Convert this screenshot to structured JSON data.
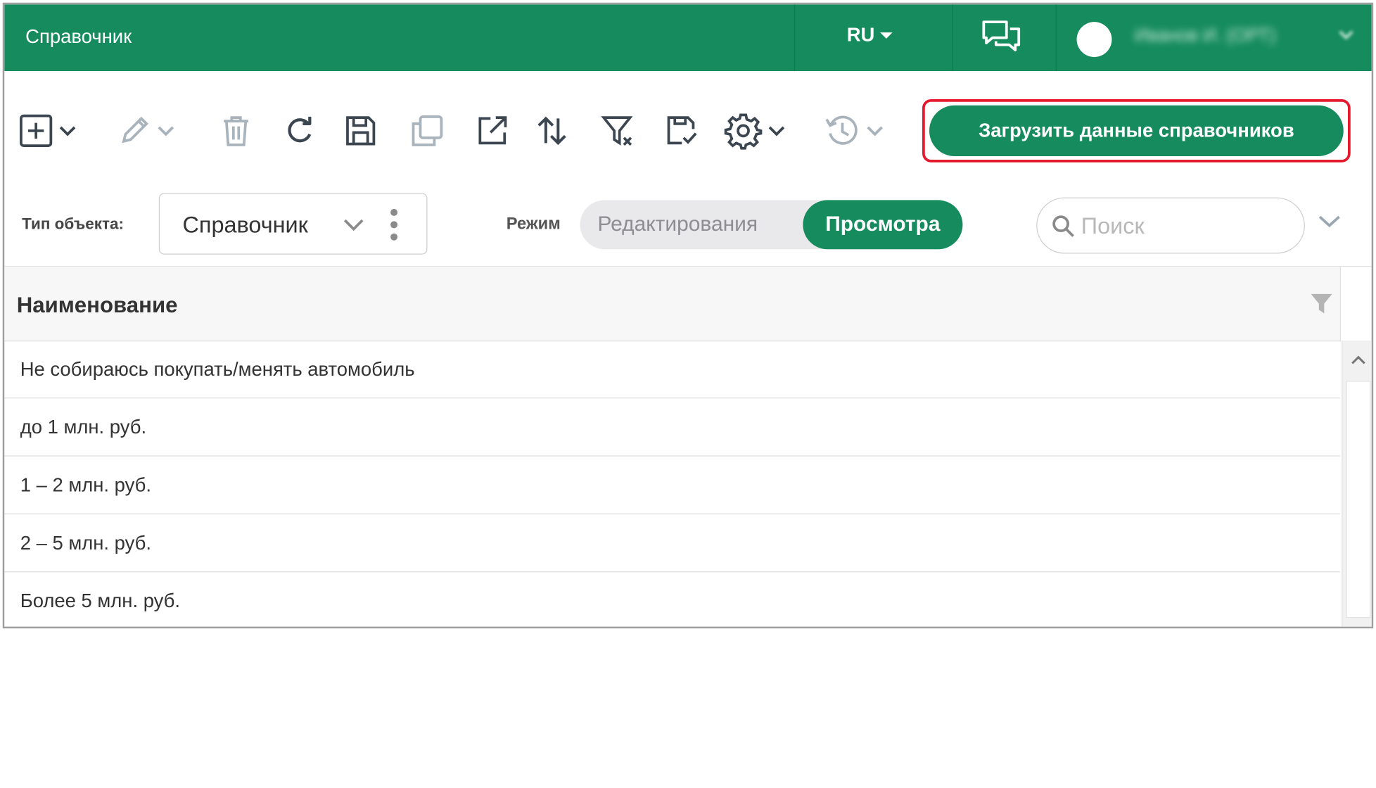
{
  "header": {
    "app_title": "Справочник",
    "language": "RU",
    "user_name": "Иванов И. (ОРТ)"
  },
  "toolbar": {
    "load_button_label": "Загрузить данные справочников",
    "icons": [
      "add-icon",
      "edit-icon",
      "delete-icon",
      "refresh-icon",
      "save-icon",
      "copy-icon",
      "export-icon",
      "sort-icon",
      "clear-filter-icon",
      "save-check-icon",
      "settings-icon",
      "history-icon"
    ]
  },
  "filters": {
    "type_label": "Тип объекта:",
    "type_value": "Справочник",
    "mode_label": "Режим",
    "mode_edit": "Редактирования",
    "mode_view": "Просмотра",
    "mode_selected": "Просмотра",
    "search_placeholder": "Поиск"
  },
  "table": {
    "column_title": "Наименование",
    "rows": [
      "Не собираюсь покупать/менять автомобиль",
      "до 1 млн. руб.",
      "1 – 2 млн. руб.",
      "2 – 5 млн. руб.",
      "Более 5 млн. руб."
    ]
  },
  "colors": {
    "brand_green": "#168c5e",
    "highlight_red": "#e4192c"
  }
}
